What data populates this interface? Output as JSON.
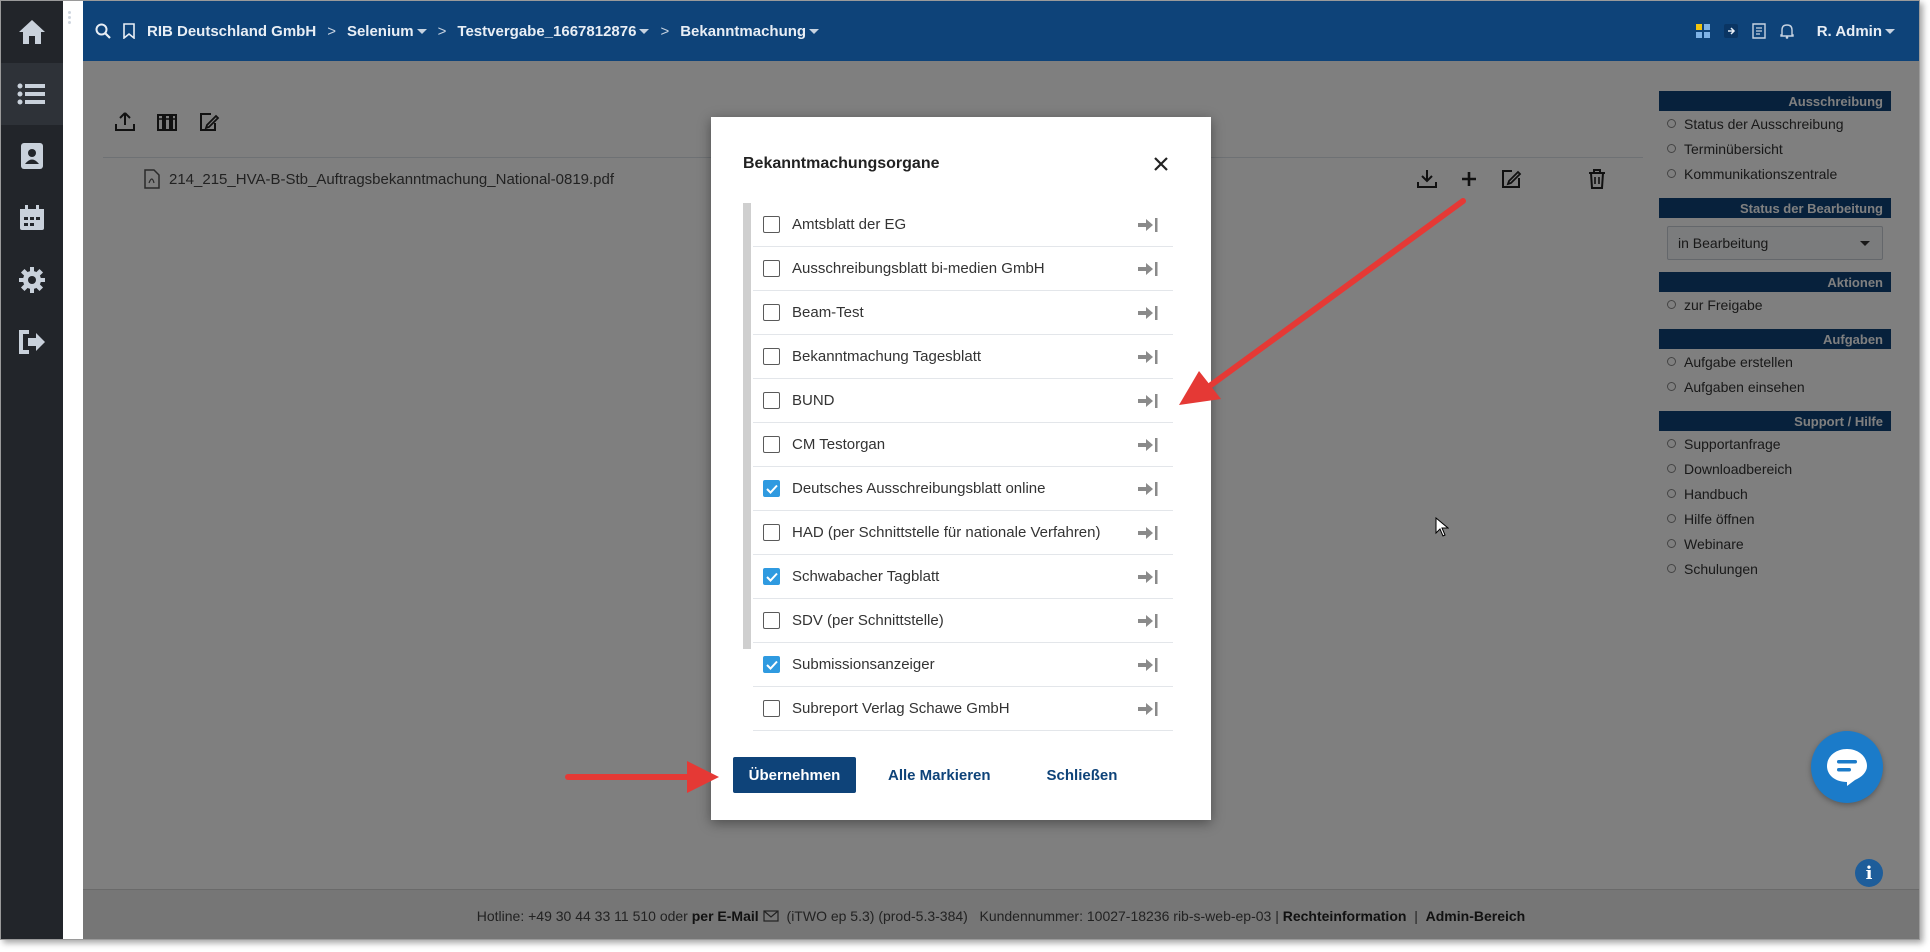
{
  "topbar": {
    "breadcrumbs": [
      {
        "label": "RIB Deutschland GmbH",
        "dropdown": false
      },
      {
        "label": "Selenium",
        "dropdown": true
      },
      {
        "label": "Testvergabe_1667812876",
        "dropdown": true
      },
      {
        "label": "Bekanntmachung",
        "dropdown": true
      }
    ],
    "user": "R. Admin"
  },
  "file": {
    "name": "214_215_HVA-B-Stb_Auftragsbekanntmachung_National-0819.pdf"
  },
  "sidebar": {
    "ausschreibung": {
      "title": "Ausschreibung",
      "items": [
        "Status der Ausschreibung",
        "Terminübersicht",
        "Kommunikationszentrale"
      ]
    },
    "status": {
      "title": "Status der Bearbeitung",
      "value": "in Bearbeitung"
    },
    "aktionen": {
      "title": "Aktionen",
      "items": [
        "zur Freigabe"
      ]
    },
    "aufgaben": {
      "title": "Aufgaben",
      "items": [
        "Aufgabe erstellen",
        "Aufgaben einsehen"
      ]
    },
    "support": {
      "title": "Support / Hilfe",
      "items": [
        "Supportanfrage",
        "Downloadbereich",
        "Handbuch",
        "Hilfe öffnen",
        "Webinare",
        "Schulungen"
      ]
    }
  },
  "modal": {
    "title": "Bekanntmachungsorgane",
    "items": [
      {
        "label": "Amtsblatt der EG",
        "checked": false
      },
      {
        "label": "Ausschreibungsblatt bi-medien GmbH",
        "checked": false
      },
      {
        "label": "Beam-Test",
        "checked": false
      },
      {
        "label": "Bekanntmachung Tagesblatt",
        "checked": false
      },
      {
        "label": "BUND",
        "checked": false
      },
      {
        "label": "CM Testorgan",
        "checked": false
      },
      {
        "label": "Deutsches Ausschreibungsblatt online",
        "checked": true
      },
      {
        "label": "HAD (per Schnittstelle für nationale Verfahren)",
        "checked": false
      },
      {
        "label": "Schwabacher Tagblatt",
        "checked": true
      },
      {
        "label": "SDV (per Schnittstelle)",
        "checked": false
      },
      {
        "label": "Submissionsanzeiger",
        "checked": true
      },
      {
        "label": "Subreport Verlag Schawe GmbH",
        "checked": false
      }
    ],
    "apply_label": "Übernehmen",
    "mark_all_label": "Alle Markieren",
    "close_label": "Schließen"
  },
  "footer": {
    "hotline": "Hotline: +49 30 44 33 11 510 oder ",
    "email": "per E-Mail",
    "version": " (iTWO ep 5.3) (prod-5.3-384)   Kundennummer: 10027-18236 rib-s-web-ep-03 | ",
    "legal": "Rechteinformation",
    "separator": "  |  ",
    "admin": "Admin-Bereich"
  },
  "colors": {
    "brand": "#0e4379",
    "checkbox": "#2f9ae0",
    "annotation": "#e53935",
    "rail": "#22252a"
  }
}
